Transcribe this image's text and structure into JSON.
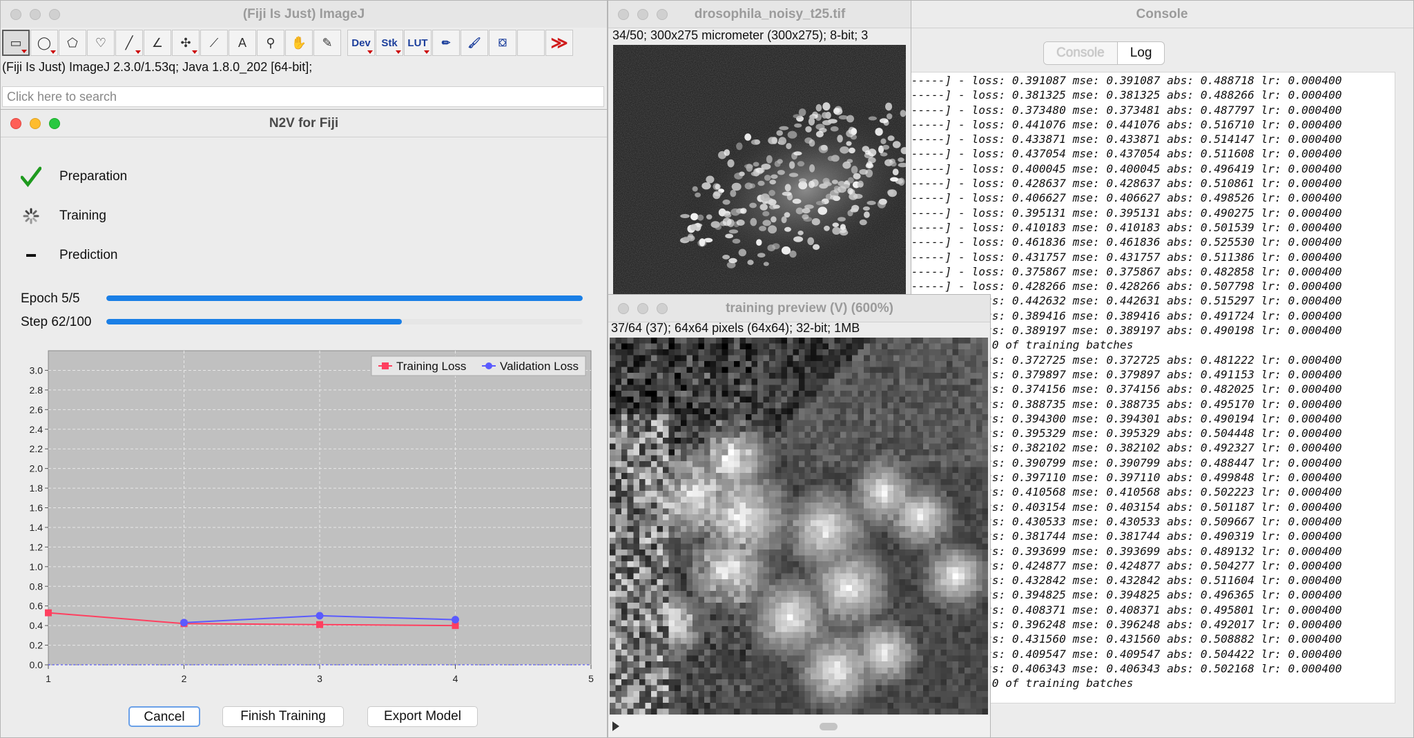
{
  "imagej": {
    "title": "(Fiji Is Just) ImageJ",
    "tools": [
      {
        "name": "rectangle-tool-icon",
        "glyph": "▭",
        "selected": true,
        "menu": true
      },
      {
        "name": "oval-tool-icon",
        "glyph": "◯",
        "menu": true
      },
      {
        "name": "polygon-tool-icon",
        "glyph": "⬠",
        "menu": false
      },
      {
        "name": "freehand-tool-icon",
        "glyph": "♡",
        "menu": false
      },
      {
        "name": "line-tool-icon",
        "glyph": "╱",
        "menu": true
      },
      {
        "name": "angle-tool-icon",
        "glyph": "∠",
        "menu": false
      },
      {
        "name": "point-tool-icon",
        "glyph": "✣",
        "menu": true
      },
      {
        "name": "wand-tool-icon",
        "glyph": "⟋",
        "menu": false
      },
      {
        "name": "text-tool-icon",
        "glyph": "A",
        "menu": false
      },
      {
        "name": "magnifier-tool-icon",
        "glyph": "⚲",
        "menu": false
      },
      {
        "name": "hand-tool-icon",
        "glyph": "✋",
        "menu": false
      },
      {
        "name": "color-picker-icon",
        "glyph": "✎",
        "menu": false
      },
      {
        "name": "dev-menu-icon",
        "glyph": "Dev",
        "blue": true,
        "menu": true
      },
      {
        "name": "stk-menu-icon",
        "glyph": "Stk",
        "blue": true,
        "menu": true
      },
      {
        "name": "lut-menu-icon",
        "glyph": "LUT",
        "blue": true,
        "menu": true
      },
      {
        "name": "pencil-tool-icon",
        "glyph": "✏",
        "blue": true,
        "menu": false
      },
      {
        "name": "brush-tool-icon",
        "glyph": "🖌",
        "blue": true,
        "menu": false
      },
      {
        "name": "flood-fill-tool-icon",
        "glyph": "⛋",
        "blue": true,
        "menu": false
      },
      {
        "name": "empty-tool-slot",
        "glyph": "",
        "menu": false
      },
      {
        "name": "more-tools-icon",
        "glyph": "≫",
        "red": true,
        "menu": false
      }
    ],
    "status": "(Fiji Is Just) ImageJ 2.3.0/1.53q; Java 1.8.0_202 [64-bit];",
    "search_placeholder": "Click here to search"
  },
  "n2v": {
    "title": "N2V for Fiji",
    "steps": [
      {
        "label": "Preparation",
        "state": "done"
      },
      {
        "label": "Training",
        "state": "running"
      },
      {
        "label": "Prediction",
        "state": "pending"
      }
    ],
    "epoch_label": "Epoch 5/5",
    "epoch_progress": 1.0,
    "step_label": "Step 62/100",
    "step_progress": 0.62,
    "buttons": {
      "cancel": "Cancel",
      "finish": "Finish Training",
      "export": "Export Model"
    }
  },
  "chart_data": {
    "type": "line",
    "x": [
      1,
      2,
      3,
      4
    ],
    "series": [
      {
        "name": "Training Loss",
        "color": "#ff3f5f",
        "marker": "square",
        "values": [
          0.53,
          0.42,
          0.41,
          0.4
        ]
      },
      {
        "name": "Validation Loss",
        "color": "#5a5aff",
        "marker": "circle",
        "values": [
          null,
          0.43,
          0.5,
          0.46
        ]
      }
    ],
    "xlim": [
      1,
      5
    ],
    "ylim": [
      0,
      3.2
    ],
    "xticks": [
      "1",
      "2",
      "3",
      "4",
      "5"
    ],
    "yticks": [
      "0.0",
      "0.2",
      "0.4",
      "0.6",
      "0.8",
      "1.0",
      "1.2",
      "1.4",
      "1.6",
      "1.8",
      "2.0",
      "2.2",
      "2.4",
      "2.6",
      "2.8",
      "3.0"
    ],
    "legend": "top-right",
    "grid": true,
    "background": "#c0c0c0"
  },
  "drosophila": {
    "title": "drosophila_noisy_t25.tif",
    "info": "34/50; 300x275 micrometer (300x275); 8-bit; 3"
  },
  "preview": {
    "title": "training preview (V) (600%)",
    "info": "37/64 (37); 64x64 pixels (64x64); 32-bit; 1MB"
  },
  "console": {
    "title": "Console",
    "tabs": [
      "Console",
      "Log"
    ],
    "lines": [
      "------] - loss: 0.391087 mse: 0.391087 abs: 0.488718 lr: 0.000400",
      "------] - loss: 0.381325 mse: 0.381325 abs: 0.488266 lr: 0.000400",
      "------] - loss: 0.373480 mse: 0.373481 abs: 0.487797 lr: 0.000400",
      "------] - loss: 0.441076 mse: 0.441076 abs: 0.516710 lr: 0.000400",
      "------] - loss: 0.433871 mse: 0.433871 abs: 0.514147 lr: 0.000400",
      "------] - loss: 0.437054 mse: 0.437054 abs: 0.511608 lr: 0.000400",
      "------] - loss: 0.400045 mse: 0.400045 abs: 0.496419 lr: 0.000400",
      "------] - loss: 0.428637 mse: 0.428637 abs: 0.510861 lr: 0.000400",
      "------] - loss: 0.406627 mse: 0.406627 abs: 0.498526 lr: 0.000400",
      "------] - loss: 0.395131 mse: 0.395131 abs: 0.490275 lr: 0.000400",
      "------] - loss: 0.410183 mse: 0.410183 abs: 0.501539 lr: 0.000400",
      "------] - loss: 0.461836 mse: 0.461836 abs: 0.525530 lr: 0.000400",
      "------] - loss: 0.431757 mse: 0.431757 abs: 0.511386 lr: 0.000400",
      "------] - loss: 0.375867 mse: 0.375867 abs: 0.482858 lr: 0.000400",
      "------] - loss: 0.428266 mse: 0.428266 abs: 0.507798 lr: 0.000400",
      "------] - loss: 0.442632 mse: 0.442631 abs: 0.515297 lr: 0.000400",
      "------] - loss: 0.389416 mse: 0.389416 abs: 0.491724 lr: 0.000400",
      "------] - loss: 0.389197 mse: 0.389197 abs: 0.490198 lr: 0.000400",
      "             0 of training batches",
      "------] - loss: 0.372725 mse: 0.372725 abs: 0.481222 lr: 0.000400",
      "------] - loss: 0.379897 mse: 0.379897 abs: 0.491153 lr: 0.000400",
      "------] - loss: 0.374156 mse: 0.374156 abs: 0.482025 lr: 0.000400",
      "------] - loss: 0.388735 mse: 0.388735 abs: 0.495170 lr: 0.000400",
      "------] - loss: 0.394300 mse: 0.394301 abs: 0.490194 lr: 0.000400",
      "------] - loss: 0.395329 mse: 0.395329 abs: 0.504448 lr: 0.000400",
      "------] - loss: 0.382102 mse: 0.382102 abs: 0.492327 lr: 0.000400",
      "------] - loss: 0.390799 mse: 0.390799 abs: 0.488447 lr: 0.000400",
      "------] - loss: 0.397110 mse: 0.397110 abs: 0.499848 lr: 0.000400",
      "------] - loss: 0.410568 mse: 0.410568 abs: 0.502223 lr: 0.000400",
      "------] - loss: 0.403154 mse: 0.403154 abs: 0.501187 lr: 0.000400",
      "------] - loss: 0.430533 mse: 0.430533 abs: 0.509667 lr: 0.000400",
      "------] - loss: 0.381744 mse: 0.381744 abs: 0.490319 lr: 0.000400",
      "------] - loss: 0.393699 mse: 0.393699 abs: 0.489132 lr: 0.000400",
      "------] - loss: 0.424877 mse: 0.424877 abs: 0.504277 lr: 0.000400",
      "------] - loss: 0.432842 mse: 0.432842 abs: 0.511604 lr: 0.000400",
      "------] - loss: 0.394825 mse: 0.394825 abs: 0.496365 lr: 0.000400",
      "------] - loss: 0.408371 mse: 0.408371 abs: 0.495801 lr: 0.000400",
      "------] - loss: 0.396248 mse: 0.396248 abs: 0.492017 lr: 0.000400",
      "------] - loss: 0.431560 mse: 0.431560 abs: 0.508882 lr: 0.000400",
      "------] - loss: 0.409547 mse: 0.409547 abs: 0.504422 lr: 0.000400",
      "------] - loss: 0.406343 mse: 0.406343 abs: 0.502168 lr: 0.000400",
      "             0 of training batches"
    ]
  }
}
